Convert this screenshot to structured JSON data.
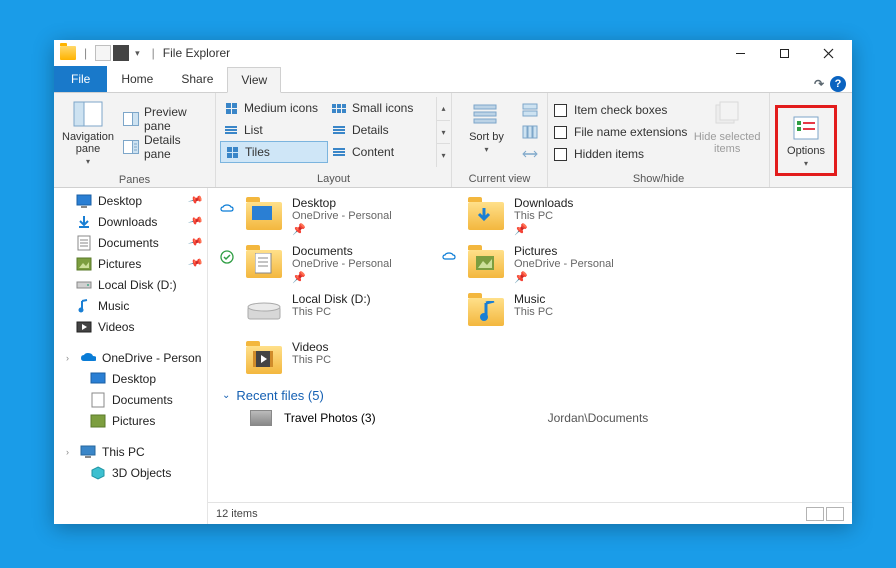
{
  "window": {
    "title": "File Explorer"
  },
  "win_controls": {
    "min": "–",
    "max": "☐",
    "close": "✕"
  },
  "tabs": {
    "file": "File",
    "home": "Home",
    "share": "Share",
    "view": "View"
  },
  "ribbon": {
    "panes": {
      "label": "Panes",
      "navigation": "Navigation pane",
      "preview": "Preview pane",
      "details": "Details pane"
    },
    "layout": {
      "label": "Layout",
      "medium": "Medium icons",
      "small": "Small icons",
      "list": "List",
      "details": "Details",
      "tiles": "Tiles",
      "content": "Content"
    },
    "current_view": {
      "label": "Current view",
      "sort": "Sort by"
    },
    "show_hide": {
      "label": "Show/hide",
      "check_boxes": "Item check boxes",
      "extensions": "File name extensions",
      "hidden": "Hidden items",
      "hide_selected": "Hide selected items"
    },
    "options": "Options"
  },
  "sidebar": {
    "desktop": "Desktop",
    "downloads": "Downloads",
    "documents": "Documents",
    "pictures": "Pictures",
    "localdisk": "Local Disk (D:)",
    "music": "Music",
    "videos": "Videos",
    "onedrive": "OneDrive - Person",
    "od_desktop": "Desktop",
    "od_documents": "Documents",
    "od_pictures": "Pictures",
    "thispc": "This PC",
    "objects3d": "3D Objects"
  },
  "tiles": {
    "desktop": {
      "name": "Desktop",
      "sub": "OneDrive - Personal"
    },
    "downloads": {
      "name": "Downloads",
      "sub": "This PC"
    },
    "documents": {
      "name": "Documents",
      "sub": "OneDrive - Personal"
    },
    "pictures": {
      "name": "Pictures",
      "sub": "OneDrive - Personal"
    },
    "localdisk": {
      "name": "Local Disk (D:)",
      "sub": "This PC"
    },
    "music": {
      "name": "Music",
      "sub": "This PC"
    },
    "videos": {
      "name": "Videos",
      "sub": "This PC"
    }
  },
  "recent": {
    "header": "Recent files (5)",
    "item_name": "Travel Photos (3)",
    "item_path": "Jordan\\Documents"
  },
  "status": {
    "count": "12 items"
  }
}
